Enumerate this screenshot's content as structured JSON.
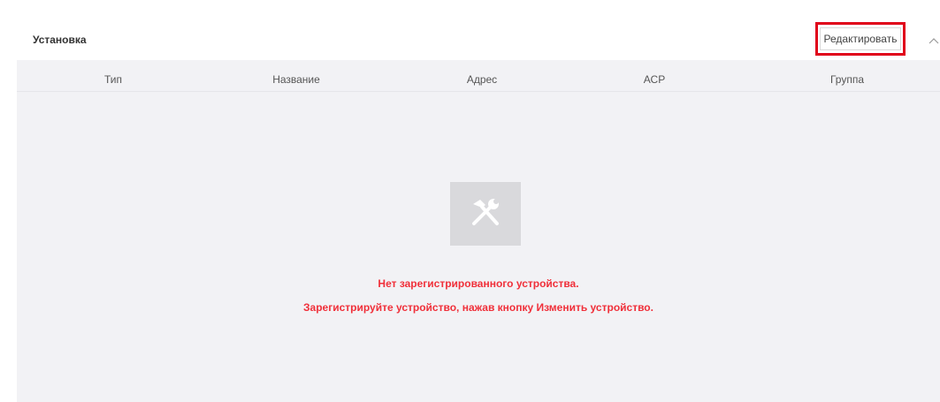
{
  "panel": {
    "title": "Установка",
    "edit_button_label": "Редактировать"
  },
  "table": {
    "columns": [
      "Тип",
      "Название",
      "Адрес",
      "АСР",
      "Группа"
    ]
  },
  "empty_state": {
    "icon": "tools-icon",
    "line1": "Нет зарегистрированного устройства.",
    "line2": "Зарегистрируйте устройство, нажав кнопку Изменить устройство."
  },
  "colors": {
    "highlight": "#e0001a",
    "message": "#f0303a",
    "background": "#f2f2f5"
  }
}
